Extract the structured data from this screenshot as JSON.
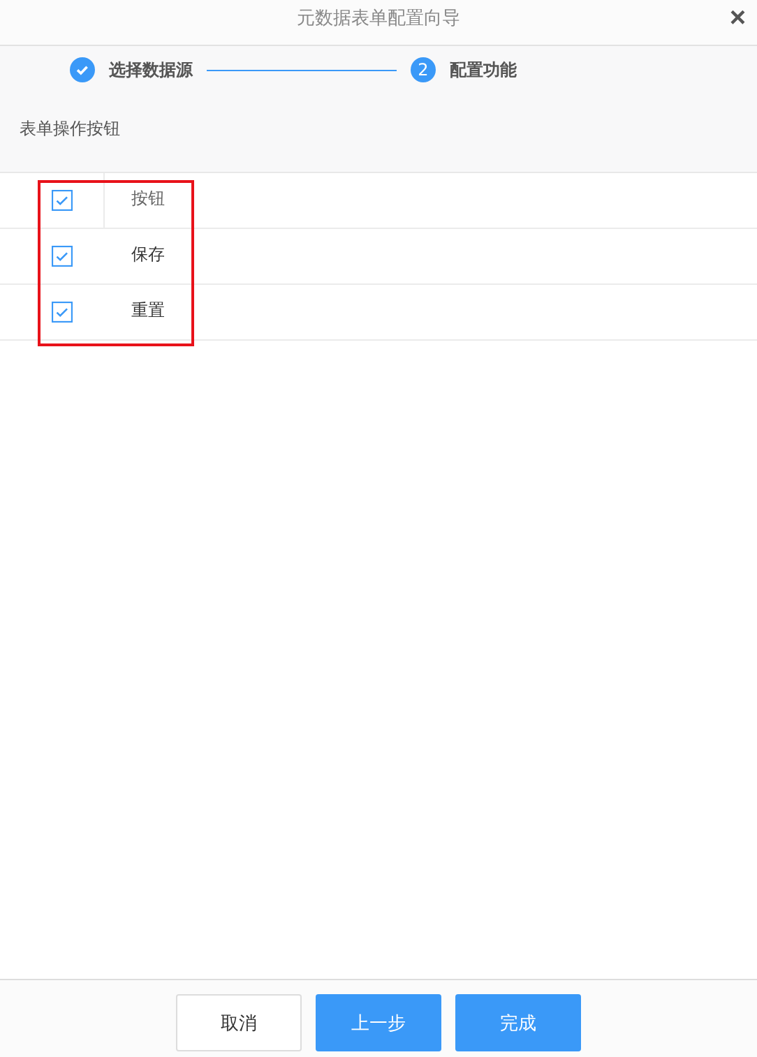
{
  "window": {
    "title": "元数据表单配置向导",
    "close": "×"
  },
  "steps": [
    {
      "label": "选择数据源",
      "done": true
    },
    {
      "label": "配置功能",
      "number": "2",
      "done": false
    }
  ],
  "section": {
    "label": "表单操作按钮"
  },
  "table": {
    "header": {
      "label": "按钮",
      "checked": true
    },
    "rows": [
      {
        "label": "保存",
        "checked": true
      },
      {
        "label": "重置",
        "checked": true
      }
    ],
    "highlighted": true
  },
  "buttons": [
    {
      "label": "取消",
      "kind": "default"
    },
    {
      "label": "上一步",
      "kind": "primary"
    },
    {
      "label": "完成",
      "kind": "primary"
    }
  ]
}
